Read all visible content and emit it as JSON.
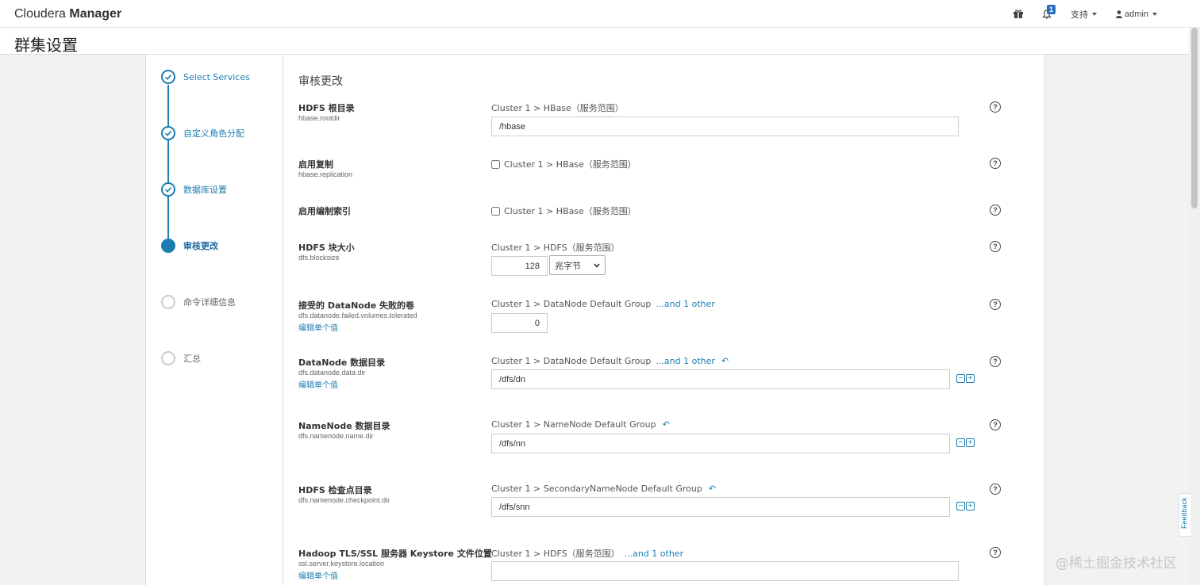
{
  "app": {
    "brand_light": "Cloudera ",
    "brand_bold": "Manager"
  },
  "topnav": {
    "notification_count": "1",
    "support_label": "支持",
    "user_label": "admin"
  },
  "page": {
    "title": "群集设置"
  },
  "wizard": {
    "steps": [
      {
        "label": "Select Services",
        "state": "done"
      },
      {
        "label": "自定义角色分配",
        "state": "done"
      },
      {
        "label": "数据库设置",
        "state": "done"
      },
      {
        "label": "审核更改",
        "state": "active"
      },
      {
        "label": "命令详细信息",
        "state": "pending"
      },
      {
        "label": "汇总",
        "state": "pending"
      }
    ]
  },
  "main": {
    "section_title": "审核更改",
    "edit_single_label": "编辑单个值",
    "help_glyph": "?",
    "params": [
      {
        "name": "HDFS 根目录",
        "key": "hbase.rootdir",
        "scope": "Cluster 1 > HBase（服务范围）",
        "value": "/hbase"
      },
      {
        "name": "启用复制",
        "key": "hbase.replication",
        "scope": "Cluster 1 > HBase（服务范围）",
        "checked": false
      },
      {
        "name": "启用编制索引",
        "key": "",
        "scope": "Cluster 1 > HBase（服务范围）",
        "checked": false
      },
      {
        "name": "HDFS 块大小",
        "key": "dfs.blocksize",
        "scope": "Cluster 1 > HDFS（服务范围）",
        "value": "128",
        "unit": "兆字节"
      },
      {
        "name": "接受的 DataNode 失败的卷",
        "key": "dfs.datanode.failed.volumes.tolerated",
        "scope": "Cluster 1 > DataNode Default Group",
        "other": "...and 1 other",
        "value": "0"
      },
      {
        "name": "DataNode 数据目录",
        "key": "dfs.datanode.data.dir",
        "scope": "Cluster 1 > DataNode Default Group",
        "other": "...and 1 other",
        "value": "/dfs/dn"
      },
      {
        "name": "NameNode 数据目录",
        "key": "dfs.namenode.name.dir",
        "scope": "Cluster 1 > NameNode Default Group",
        "value": "/dfs/nn"
      },
      {
        "name": "HDFS 检查点目录",
        "key": "dfs.namenode.checkpoint.dir",
        "scope": "Cluster 1 > SecondaryNameNode Default Group",
        "value": "/dfs/snn"
      },
      {
        "name": "Hadoop TLS/SSL 服务器 Keystore 文件位置",
        "key": "ssl.server.keystore.location",
        "scope": "Cluster 1 > HDFS（服务范围）",
        "other": "...and 1 other",
        "value": ""
      }
    ]
  },
  "feedback_label": "Feedback",
  "watermark": "@稀土掘金技术社区",
  "colors": {
    "accent": "#1e7db0",
    "badge": "#2a6ebb"
  }
}
